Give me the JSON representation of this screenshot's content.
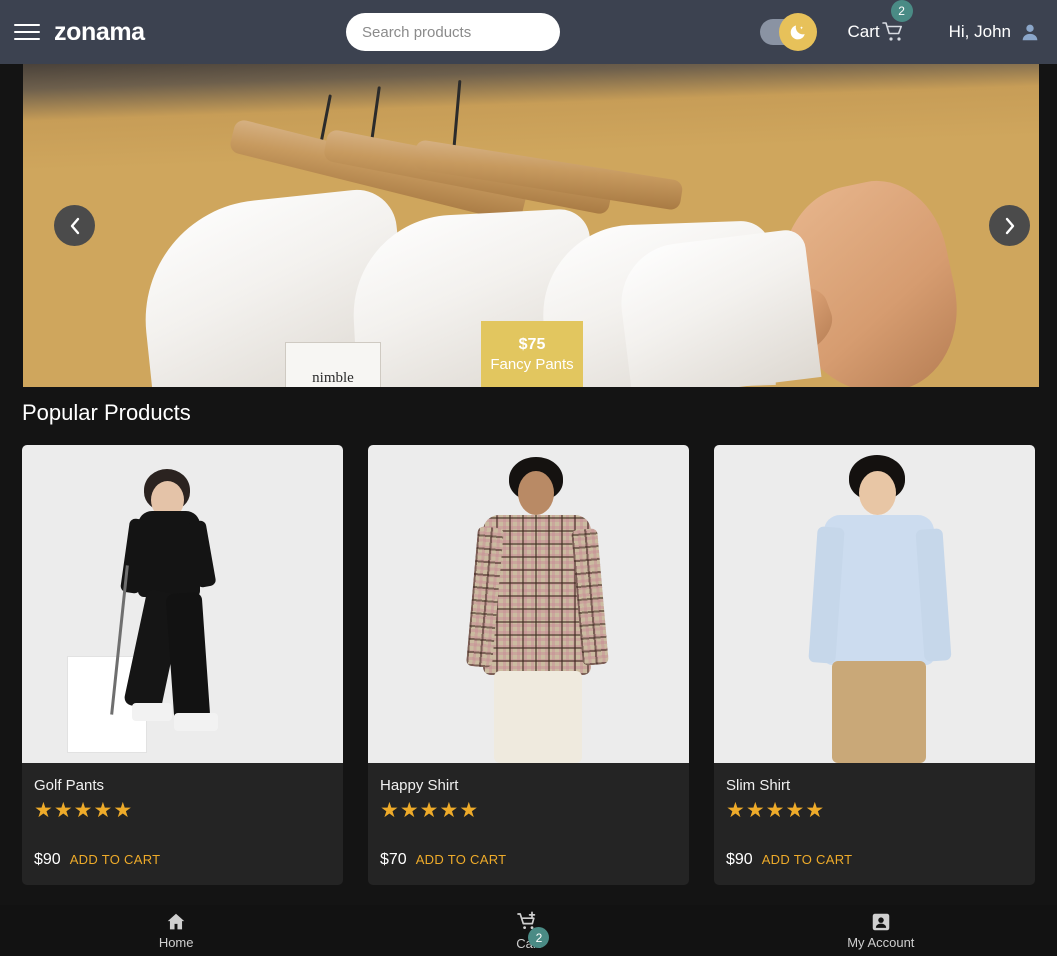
{
  "header": {
    "menu_icon": "hamburger-icon",
    "logo": "zonama",
    "search": {
      "placeholder": "Search products",
      "value": "",
      "search_icon": "search-icon"
    },
    "theme_toggle": {
      "state": "dark",
      "icon": "moon-icon"
    },
    "cart": {
      "label": "Cart",
      "icon": "shopping-cart-icon",
      "badge_count": "2"
    },
    "account": {
      "greeting": "Hi, John",
      "icon": "user-avatar-icon"
    }
  },
  "banner": {
    "prev_icon": "chevron-left-icon",
    "next_icon": "chevron-right-icon",
    "caption": {
      "price": "$75",
      "title": "Fancy Pants"
    },
    "image_label_text": "nimble"
  },
  "main": {
    "section_title": "Popular Products",
    "products": [
      {
        "name": "Golf Pants",
        "price": "$90",
        "rating": 5,
        "add_to_cart_label": "ADD TO CART"
      },
      {
        "name": "Happy Shirt",
        "price": "$70",
        "rating": 5,
        "add_to_cart_label": "ADD TO CART"
      },
      {
        "name": "Slim Shirt",
        "price": "$90",
        "rating": 5,
        "add_to_cart_label": "ADD TO CART"
      }
    ]
  },
  "bottom_nav": {
    "items": [
      {
        "label": "Home",
        "icon": "home-icon",
        "badge": ""
      },
      {
        "label": "Cart",
        "icon": "add-shopping-cart-icon",
        "badge": "2"
      },
      {
        "label": "My Account",
        "icon": "account-box-icon",
        "badge": ""
      }
    ]
  },
  "colors": {
    "header_bg": "#3c4250",
    "page_bg": "#141414",
    "card_bg": "#242424",
    "accent_gold": "#e7c15a",
    "star_gold": "#eeab2a",
    "badge_teal": "#4a8b85"
  }
}
